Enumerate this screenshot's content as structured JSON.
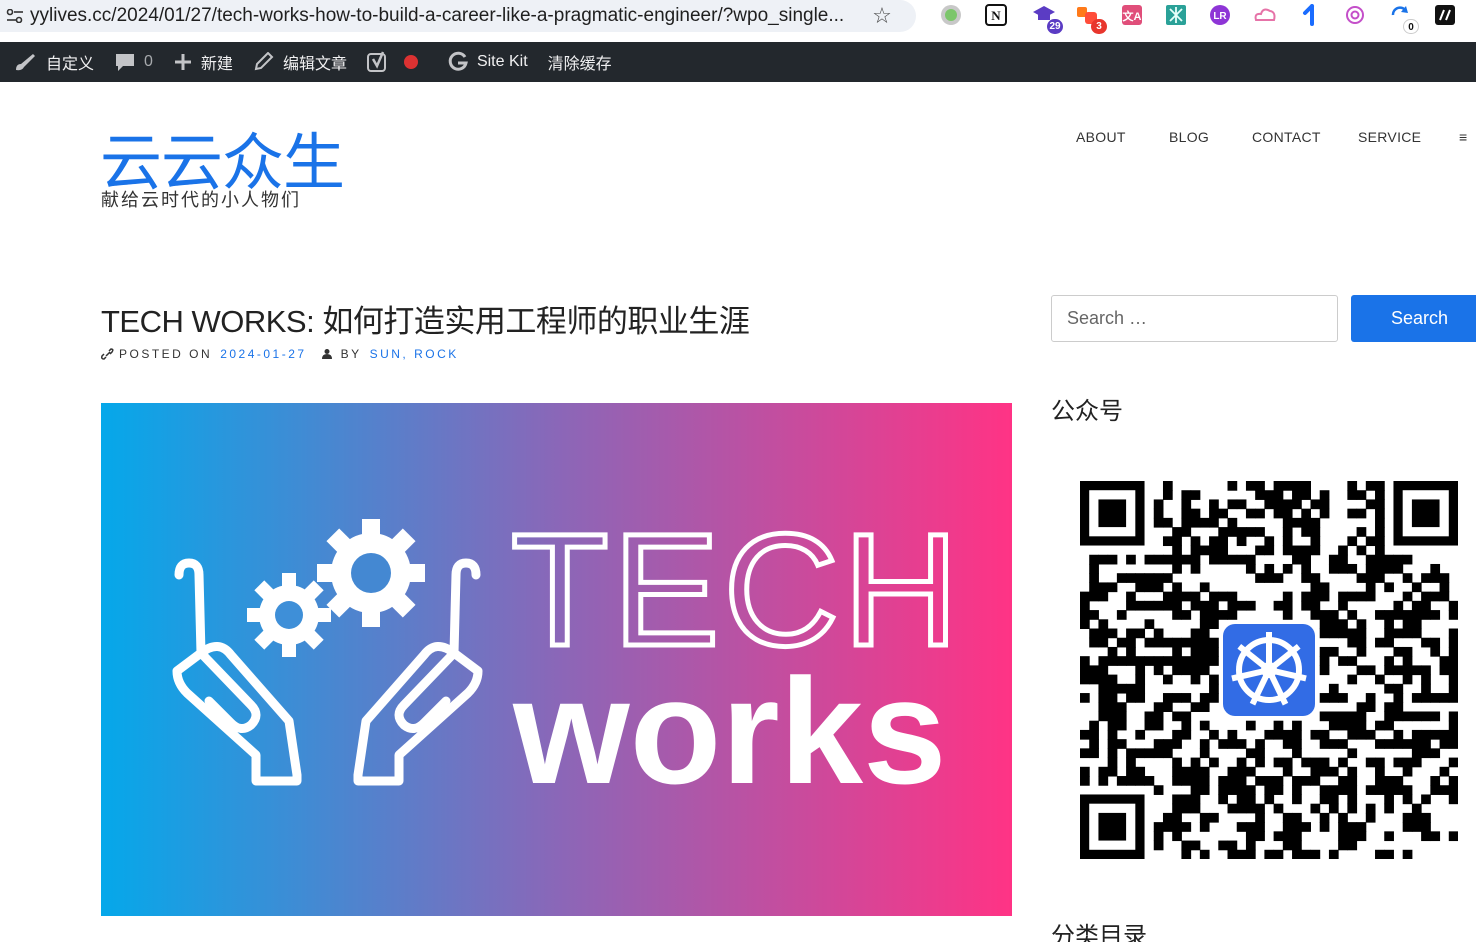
{
  "browser": {
    "url": "yylives.cc/2024/01/27/tech-works-how-to-build-a-career-like-a-pragmatic-engineer/?wpo_single...",
    "extensions": [
      {
        "name": "green-circle-extension-icon",
        "badge": ""
      },
      {
        "name": "notion-extension-icon",
        "badge": ""
      },
      {
        "name": "graduation-cap-extension-icon",
        "badge": "29"
      },
      {
        "name": "orange-blocks-extension-icon",
        "badge": "3"
      },
      {
        "name": "translate-extension-icon",
        "badge": ""
      },
      {
        "name": "teal-pattern-extension-icon",
        "badge": ""
      },
      {
        "name": "purple-logo-extension-icon",
        "badge": ""
      },
      {
        "name": "pink-cloud-extension-icon",
        "badge": ""
      },
      {
        "name": "blue-arrow-extension-icon",
        "badge": ""
      },
      {
        "name": "openai-extension-icon",
        "badge": ""
      },
      {
        "name": "sync-extension-icon",
        "badge": "0"
      },
      {
        "name": "dark-square-extension-icon",
        "badge": ""
      }
    ]
  },
  "adminbar": {
    "customize": "自定义",
    "comments_count": "0",
    "new": "新建",
    "edit_post": "编辑文章",
    "sitekit": "Site Kit",
    "clear_cache": "清除缓存"
  },
  "site": {
    "title": "云云众生",
    "tagline": "献给云时代的小人物们"
  },
  "nav": {
    "about": "ABOUT",
    "blog": "BLOG",
    "contact": "CONTACT",
    "service": "SERVICE",
    "menu": "≡"
  },
  "post": {
    "title": "TECH WORKS: 如何打造实用工程师的职业生涯",
    "posted_on_label": "POSTED ON",
    "date": "2024-01-27",
    "by_label": "BY",
    "author": "SUN, ROCK",
    "image": {
      "line1": "TECH",
      "line2": "works"
    }
  },
  "sidebar": {
    "search_placeholder": "Search …",
    "search_button": "Search",
    "widget1_title": "公众号",
    "widget2_title": "分类目录"
  },
  "colors": {
    "accent": "#1a73e8",
    "adminbar": "#23282d",
    "gradient_start": "#05a8ea",
    "gradient_end": "#ff3385"
  }
}
